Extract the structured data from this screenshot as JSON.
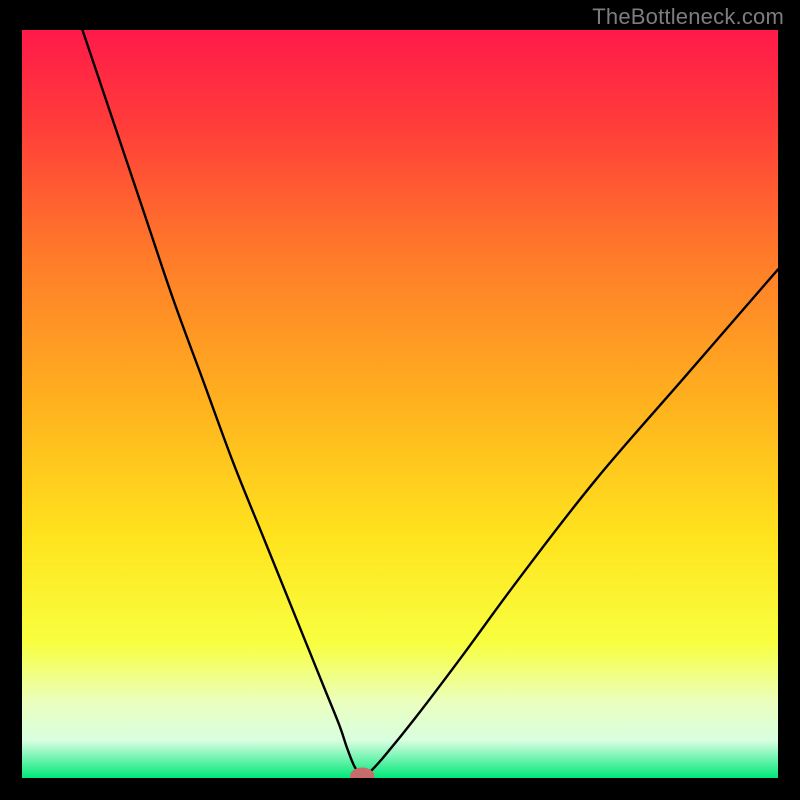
{
  "watermark": "TheBottleneck.com",
  "colors": {
    "frame": "#000000",
    "curve_stroke": "#000000",
    "marker_fill": "#c86b6b",
    "gradient_stops": [
      {
        "offset": 0.0,
        "color": "#ff1a4a"
      },
      {
        "offset": 0.12,
        "color": "#ff3a3a"
      },
      {
        "offset": 0.3,
        "color": "#ff7a2a"
      },
      {
        "offset": 0.5,
        "color": "#ffb21e"
      },
      {
        "offset": 0.68,
        "color": "#ffe41e"
      },
      {
        "offset": 0.82,
        "color": "#f8ff40"
      },
      {
        "offset": 0.9,
        "color": "#eaffc0"
      },
      {
        "offset": 0.95,
        "color": "#d8ffe0"
      },
      {
        "offset": 1.0,
        "color": "#00e87a"
      }
    ]
  },
  "chart_data": {
    "type": "line",
    "title": "",
    "xlabel": "",
    "ylabel": "",
    "xlim": [
      0,
      100
    ],
    "ylim": [
      0,
      100
    ],
    "series": [
      {
        "name": "bottleneck-curve",
        "x": [
          8,
          12,
          16,
          20,
          24,
          28,
          32,
          36,
          38,
          40,
          42,
          43,
          44,
          45,
          46,
          48,
          52,
          58,
          66,
          76,
          88,
          100
        ],
        "y": [
          100,
          88,
          76,
          64,
          53,
          42,
          32,
          22,
          17,
          12,
          7,
          4,
          1.5,
          0.3,
          0.8,
          3,
          8,
          16,
          27,
          40,
          54,
          68
        ]
      }
    ],
    "marker": {
      "x": 45,
      "y": 0.3,
      "rx": 1.6,
      "ry": 1.1
    }
  }
}
